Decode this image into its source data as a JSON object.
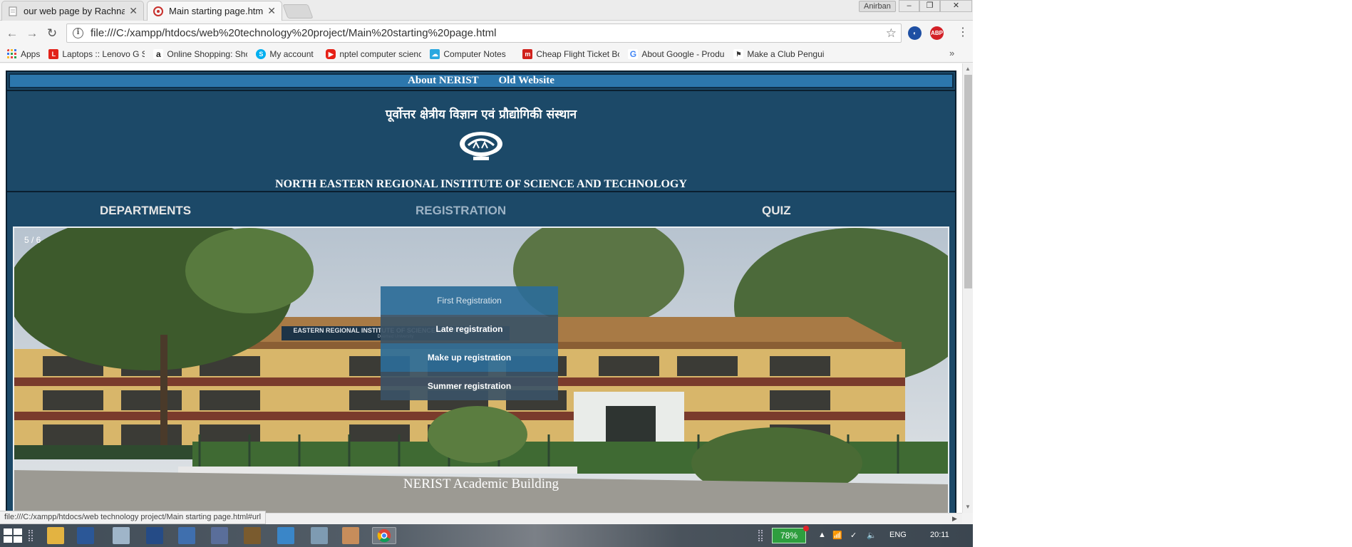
{
  "browser": {
    "tabs": [
      {
        "title": "our web page by Rachna",
        "active": false
      },
      {
        "title": "Main starting page.html",
        "active": true
      }
    ],
    "user": "Anirban",
    "window_buttons": [
      "–",
      "❐",
      "✕"
    ],
    "address": "file:///C:/xampp/htdocs/web%20technology%20project/Main%20starting%20page.html",
    "info_glyph": "i",
    "bookmarks": [
      {
        "label": "Apps",
        "icon": "apps-grid-icon",
        "color": "#3b78e7"
      },
      {
        "label": "Laptops :: Lenovo G S",
        "icon": "lenovo-icon",
        "color": "#e2231a"
      },
      {
        "label": "Online Shopping: Sho",
        "icon": "amazon-icon",
        "color": "#222222"
      },
      {
        "label": "My account",
        "icon": "skype-icon",
        "color": "#00aff0"
      },
      {
        "label": "nptel computer scienc",
        "icon": "youtube-icon",
        "color": "#e62117"
      },
      {
        "label": "Computer Notes",
        "icon": "cloud-icon",
        "color": "#29a8e0"
      },
      {
        "label": "Cheap Flight Ticket Bo",
        "icon": "makemytrip-icon",
        "color": "#d0211c"
      },
      {
        "label": "About Google - Produ",
        "icon": "google-icon",
        "color": "#4285f4"
      },
      {
        "label": "Make a Club Penguin",
        "icon": "penguin-icon",
        "color": "#555555"
      }
    ],
    "more_glyph": "»",
    "status_url": "file:///C:/xampp/htdocs/web technology project/Main starting page.html#url"
  },
  "site": {
    "topnav": [
      "About NERIST",
      "Old Website"
    ],
    "hindi_title": "पूर्वोत्तर क्षेत्रीय विज्ञान एवं प्रौद्योगिकी संस्थान",
    "institute_name": "NORTH EASTERN REGIONAL INSTITUTE OF SCIENCE AND TECHNOLOGY",
    "nav": [
      "DEPARTMENTS",
      "REGISTRATION",
      "QUIZ"
    ],
    "registration_menu": [
      "First Registration",
      "Late registration",
      "Make up registration",
      "Summer registration"
    ],
    "slide_counter": "5 / 6",
    "building_sign": "EASTERN REGIONAL INSTITUTE OF SCIENCE AND TECHNOLOGY",
    "building_sign_sub": "Deemed University",
    "caption": "NERIST Academic Building"
  },
  "taskbar": {
    "battery": "78%",
    "language": "ENG",
    "time": "20:11"
  },
  "colors": {
    "site_bg": "#1c4968",
    "topnav_bg": "#2c77ad",
    "menu_item_a": "#2d6d98",
    "menu_item_b": "#3b5366"
  }
}
